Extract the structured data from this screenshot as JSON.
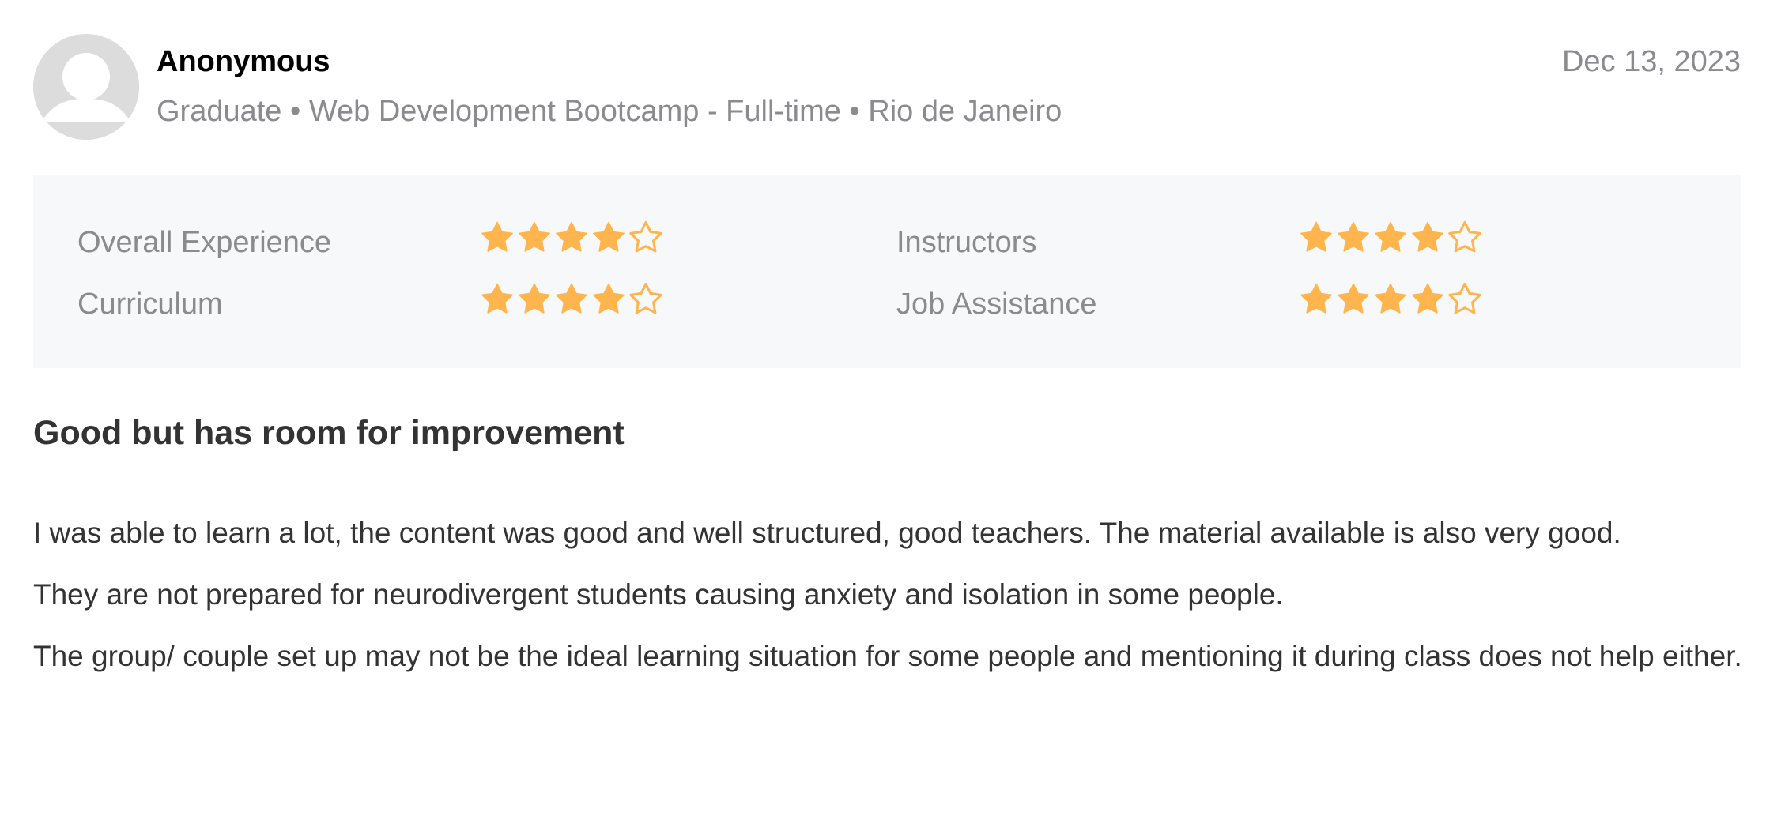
{
  "review": {
    "reviewer": {
      "name": "Anonymous",
      "meta": "Graduate • Web Development Bootcamp - Full-time • Rio de Janeiro",
      "avatar_icon": "default-user-icon"
    },
    "date": "Dec 13, 2023",
    "ratings": [
      {
        "label": "Overall Experience",
        "score": 4,
        "max": 5
      },
      {
        "label": "Instructors",
        "score": 4,
        "max": 5
      },
      {
        "label": "Curriculum",
        "score": 4,
        "max": 5
      },
      {
        "label": "Job Assistance",
        "score": 4,
        "max": 5
      }
    ],
    "title": "Good but has room for improvement",
    "body": [
      "I was able to learn a lot, the content was good and well structured, good teachers. The material available is also very good.",
      "They are not prepared for neurodivergent students causing anxiety and isolation in some people.",
      "The group/ couple set up may not be the ideal learning situation for some people and mentioning it during class does not help either."
    ]
  },
  "colors": {
    "star_filled": "#ffb54d",
    "ratings_background": "#f7f8f9",
    "muted_text": "#8a8a8f",
    "avatar_background": "#dcdcdc"
  }
}
